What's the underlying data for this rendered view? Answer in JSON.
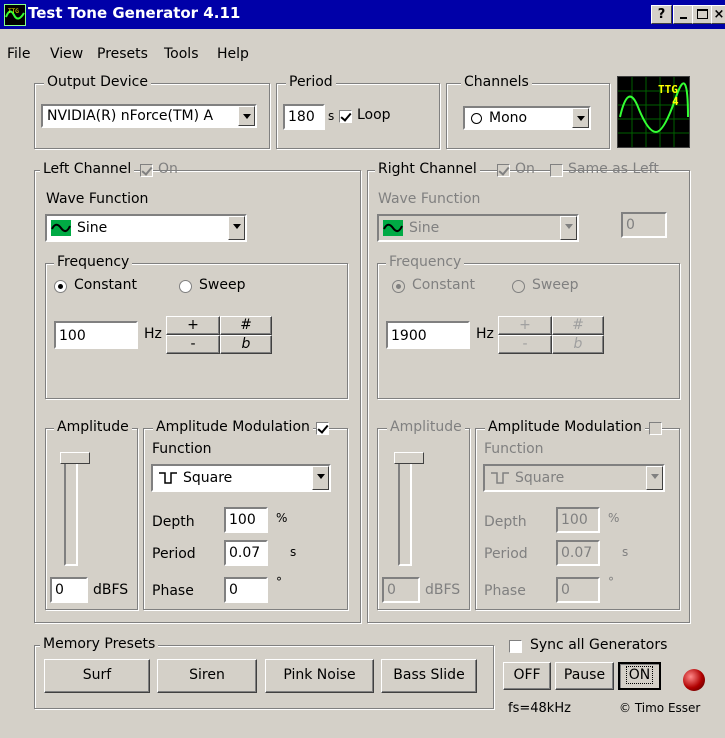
{
  "window": {
    "title": "Test Tone Generator 4.11",
    "help_btn": "?",
    "min_btn": "_",
    "max_btn": "□",
    "close_btn": "×",
    "icon_text": "TTG"
  },
  "menu": {
    "items": [
      "File",
      "View",
      "Presets",
      "Tools",
      "Help"
    ]
  },
  "output_device": {
    "label": "Output Device",
    "value": "NVIDIA(R) nForce(TM) A"
  },
  "period": {
    "label": "Period",
    "value": "180",
    "unit": "s",
    "loop_label": "Loop",
    "loop_checked": true
  },
  "channels": {
    "label": "Channels",
    "value": "Mono"
  },
  "scope": {
    "text1": "TTG",
    "text2": "4"
  },
  "left": {
    "label": "Left Channel",
    "on_label": "On",
    "wave_label": "Wave Function",
    "wave_value": "Sine",
    "freq_label": "Frequency",
    "constant_label": "Constant",
    "sweep_label": "Sweep",
    "freq_value": "100",
    "hz": "Hz",
    "plus": "+",
    "minus": "-",
    "sharp": "#",
    "flat": "b",
    "amp_label": "Amplitude",
    "amp_value": "0",
    "dbfs": "dBFS",
    "am_label": "Amplitude Modulation",
    "am_checked": true,
    "func_label": "Function",
    "func_value": "Square",
    "depth_label": "Depth",
    "depth_value": "100",
    "depth_unit": "%",
    "period_label": "Period",
    "period_value": "0.07",
    "period_unit": "s",
    "phase_label": "Phase",
    "phase_value": "0",
    "phase_unit": "°"
  },
  "right": {
    "label": "Right Channel",
    "on_label": "On",
    "same_label": "Same as Left",
    "wave_label": "Wave Function",
    "wave_value": "Sine",
    "offset_value": "0",
    "freq_label": "Frequency",
    "constant_label": "Constant",
    "sweep_label": "Sweep",
    "freq_value": "1900",
    "hz": "Hz",
    "plus": "+",
    "minus": "-",
    "sharp": "#",
    "flat": "b",
    "amp_label": "Amplitude",
    "amp_value": "0",
    "dbfs": "dBFS",
    "am_label": "Amplitude Modulation",
    "am_checked": false,
    "func_label": "Function",
    "func_value": "Square",
    "depth_label": "Depth",
    "depth_value": "100",
    "depth_unit": "%",
    "period_label": "Period",
    "period_value": "0.07",
    "period_unit": "s",
    "phase_label": "Phase",
    "phase_value": "0",
    "phase_unit": "°"
  },
  "presets": {
    "label": "Memory Presets",
    "items": [
      "Surf",
      "Siren",
      "Pink Noise",
      "Bass Slide"
    ]
  },
  "sync": {
    "label": "Sync all Generators",
    "checked": false
  },
  "transport": {
    "off": "OFF",
    "pause": "Pause",
    "on": "ON"
  },
  "status": {
    "fs": "fs=48kHz",
    "credit": "© Timo Esser"
  }
}
